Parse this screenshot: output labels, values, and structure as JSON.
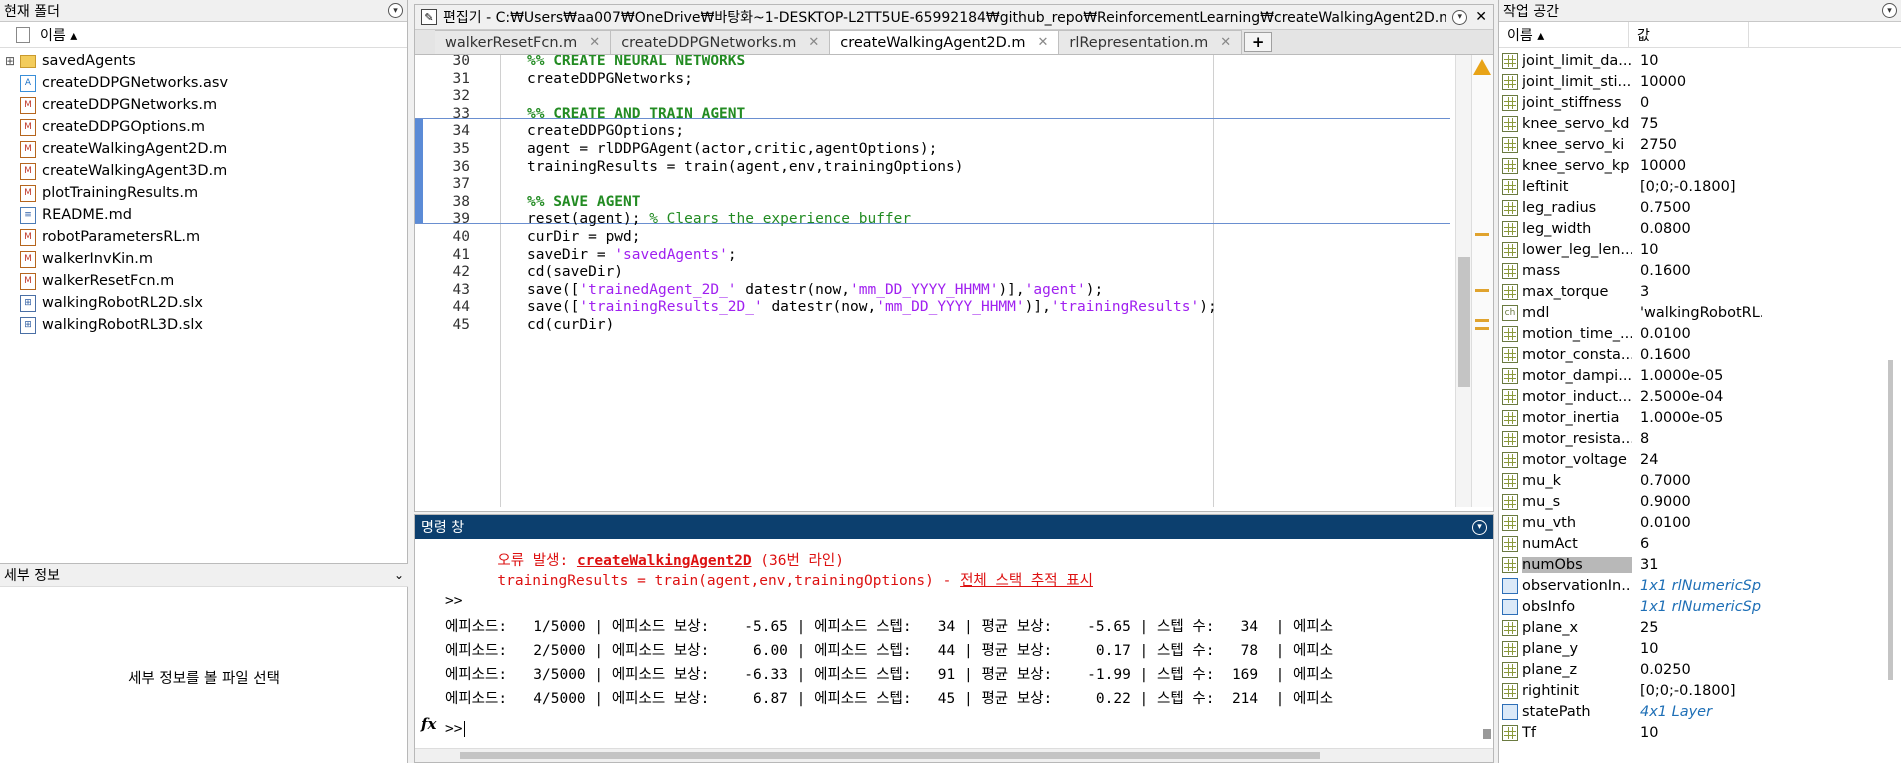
{
  "file_browser": {
    "title": "현재 폴더",
    "column_name": "이름 ▴",
    "files": [
      {
        "name": "savedAgents",
        "type": "folder",
        "icon": "folder-icon"
      },
      {
        "name": "createDDPGNetworks.asv",
        "type": "asv",
        "icon": "asv-file-icon"
      },
      {
        "name": "createDDPGNetworks.m",
        "type": "m",
        "icon": "m-file-icon"
      },
      {
        "name": "createDDPGOptions.m",
        "type": "m",
        "icon": "m-file-icon"
      },
      {
        "name": "createWalkingAgent2D.m",
        "type": "m",
        "icon": "m-file-icon"
      },
      {
        "name": "createWalkingAgent3D.m",
        "type": "m",
        "icon": "m-file-icon"
      },
      {
        "name": "plotTrainingResults.m",
        "type": "m",
        "icon": "m-file-icon"
      },
      {
        "name": "README.md",
        "type": "md",
        "icon": "md-file-icon"
      },
      {
        "name": "robotParametersRL.m",
        "type": "m",
        "icon": "m-file-icon"
      },
      {
        "name": "walkerInvKin.m",
        "type": "m",
        "icon": "m-file-icon"
      },
      {
        "name": "walkerResetFcn.m",
        "type": "m",
        "icon": "m-file-icon"
      },
      {
        "name": "walkingRobotRL2D.slx",
        "type": "slx",
        "icon": "simulink-file-icon"
      },
      {
        "name": "walkingRobotRL3D.slx",
        "type": "slx",
        "icon": "simulink-file-icon"
      }
    ],
    "details_title": "세부 정보",
    "details_message": "세부 정보를 볼 파일 선택"
  },
  "editor": {
    "title": "편집기 - C:₩Users₩aa007₩OneDrive₩바탕화~1-DESKTOP-L2TT5UE-65992184₩github_repo₩ReinforcementLearning₩createWalkingAgent2D.m",
    "tabs": [
      {
        "label": "walkerResetFcn.m",
        "active": false
      },
      {
        "label": "createDDPGNetworks.m",
        "active": false
      },
      {
        "label": "createWalkingAgent2D.m",
        "active": true
      },
      {
        "label": "rlRepresentation.m",
        "active": false
      }
    ],
    "add_tab": "+",
    "lines": [
      {
        "n": "30",
        "text": "%% CREATE NEURAL NETWORKS"
      },
      {
        "n": "31",
        "text": "createDDPGNetworks;"
      },
      {
        "n": "32",
        "text": ""
      },
      {
        "n": "33",
        "text": "%% CREATE AND TRAIN AGENT"
      },
      {
        "n": "34",
        "text": "createDDPGOptions;"
      },
      {
        "n": "35",
        "text": "agent = rlDDPGAgent(actor,critic,agentOptions);"
      },
      {
        "n": "36",
        "text": "trainingResults = train(agent,env,trainingOptions)"
      },
      {
        "n": "37",
        "text": ""
      },
      {
        "n": "38",
        "text": "%% SAVE AGENT"
      },
      {
        "n": "39",
        "text": "reset(agent); % Clears the experience buffer"
      },
      {
        "n": "40",
        "text": "curDir = pwd;"
      },
      {
        "n": "41",
        "text": "saveDir = 'savedAgents';"
      },
      {
        "n": "42",
        "text": "cd(saveDir)"
      },
      {
        "n": "43",
        "text": "save(['trainedAgent_2D_' datestr(now,'mm_DD_YYYY_HHMM')],'agent');"
      },
      {
        "n": "44",
        "text": "save(['trainingResults_2D_' datestr(now,'mm_DD_YYYY_HHMM')],'trainingResults');"
      },
      {
        "n": "45",
        "text": "cd(curDir)"
      }
    ]
  },
  "command_window": {
    "title": "명령 창",
    "error_prefix": "오류 발생: ",
    "error_link": "createWalkingAgent2D",
    "error_suffix": " (36번 라인)",
    "error_line": "trainingResults = train(agent,env,trainingOptions) - ",
    "stack_link": "전체 스택 추적 표시",
    "prompt": ">>",
    "episodes": [
      "에피소드:   1/5000 | 에피소드 보상:    -5.65 | 에피소드 스텝:   34 | 평균 보상:    -5.65 | 스텝 수:   34  | 에피소",
      "에피소드:   2/5000 | 에피소드 보상:     6.00 | 에피소드 스텝:   44 | 평균 보상:     0.17 | 스텝 수:   78  | 에피소",
      "에피소드:   3/5000 | 에피소드 보상:    -6.33 | 에피소드 스텝:   91 | 평균 보상:    -1.99 | 스텝 수:  169  | 에피소",
      "에피소드:   4/5000 | 에피소드 보상:     6.87 | 에피소드 스텝:   45 | 평균 보상:     0.22 | 스텝 수:  214  | 에피소"
    ],
    "fx_label": "fx",
    "input_prompt": ">>"
  },
  "workspace": {
    "title": "작업 공간",
    "col_name": "이름 ▴",
    "col_value": "값",
    "variables": [
      {
        "name": "joint_limit_da...",
        "value": "10",
        "icon": "grid"
      },
      {
        "name": "joint_limit_sti...",
        "value": "10000",
        "icon": "grid"
      },
      {
        "name": "joint_stiffness",
        "value": "0",
        "icon": "grid"
      },
      {
        "name": "knee_servo_kd",
        "value": "75",
        "icon": "grid"
      },
      {
        "name": "knee_servo_ki",
        "value": "2750",
        "icon": "grid"
      },
      {
        "name": "knee_servo_kp",
        "value": "10000",
        "icon": "grid"
      },
      {
        "name": "leftinit",
        "value": "[0;0;-0.1800]",
        "icon": "grid"
      },
      {
        "name": "leg_radius",
        "value": "0.7500",
        "icon": "grid"
      },
      {
        "name": "leg_width",
        "value": "0.0800",
        "icon": "grid"
      },
      {
        "name": "lower_leg_len...",
        "value": "10",
        "icon": "grid"
      },
      {
        "name": "mass",
        "value": "0.1600",
        "icon": "grid"
      },
      {
        "name": "max_torque",
        "value": "3",
        "icon": "grid"
      },
      {
        "name": "mdl",
        "value": "'walkingRobotRL...",
        "icon": "char"
      },
      {
        "name": "motion_time_...",
        "value": "0.0100",
        "icon": "grid"
      },
      {
        "name": "motor_consta...",
        "value": "0.1600",
        "icon": "grid"
      },
      {
        "name": "motor_dampi...",
        "value": "1.0000e-05",
        "icon": "grid"
      },
      {
        "name": "motor_induct...",
        "value": "2.5000e-04",
        "icon": "grid"
      },
      {
        "name": "motor_inertia",
        "value": "1.0000e-05",
        "icon": "grid"
      },
      {
        "name": "motor_resista...",
        "value": "8",
        "icon": "grid"
      },
      {
        "name": "motor_voltage",
        "value": "24",
        "icon": "grid"
      },
      {
        "name": "mu_k",
        "value": "0.7000",
        "icon": "grid"
      },
      {
        "name": "mu_s",
        "value": "0.9000",
        "icon": "grid"
      },
      {
        "name": "mu_vth",
        "value": "0.0100",
        "icon": "grid"
      },
      {
        "name": "numAct",
        "value": "6",
        "icon": "grid"
      },
      {
        "name": "numObs",
        "value": "31",
        "icon": "grid",
        "selected": true
      },
      {
        "name": "observationIn...",
        "value": "1x1 rlNumericSp...",
        "icon": "obj",
        "link": true
      },
      {
        "name": "obsInfo",
        "value": "1x1 rlNumericSp...",
        "icon": "obj",
        "link": true
      },
      {
        "name": "plane_x",
        "value": "25",
        "icon": "grid"
      },
      {
        "name": "plane_y",
        "value": "10",
        "icon": "grid"
      },
      {
        "name": "plane_z",
        "value": "0.0250",
        "icon": "grid"
      },
      {
        "name": "rightinit",
        "value": "[0;0;-0.1800]",
        "icon": "grid"
      },
      {
        "name": "statePath",
        "value": "4x1 Layer",
        "icon": "obj",
        "link": true
      },
      {
        "name": "Tf",
        "value": "10",
        "icon": "grid"
      }
    ]
  },
  "colors": {
    "command_title_bg": "#0c3f6e",
    "error_red": "#d11",
    "comment_green": "#228b22",
    "string_purple": "#a020f0",
    "cell_blue": "#5b8bd6"
  }
}
